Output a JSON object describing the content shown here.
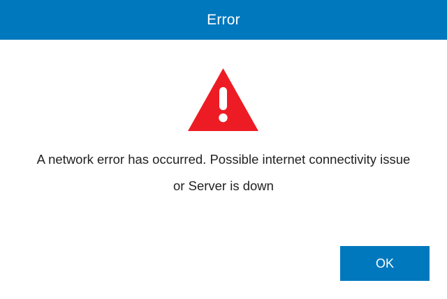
{
  "dialog": {
    "title": "Error",
    "icon": "warning-triangle-icon",
    "message_line_1": "A network error has occurred. Possible internet connectivity issue",
    "message_line_2": "or Server is down",
    "ok_label": "OK"
  },
  "colors": {
    "accent": "#0078bd",
    "warning": "#ed1c24",
    "text": "#222222"
  }
}
